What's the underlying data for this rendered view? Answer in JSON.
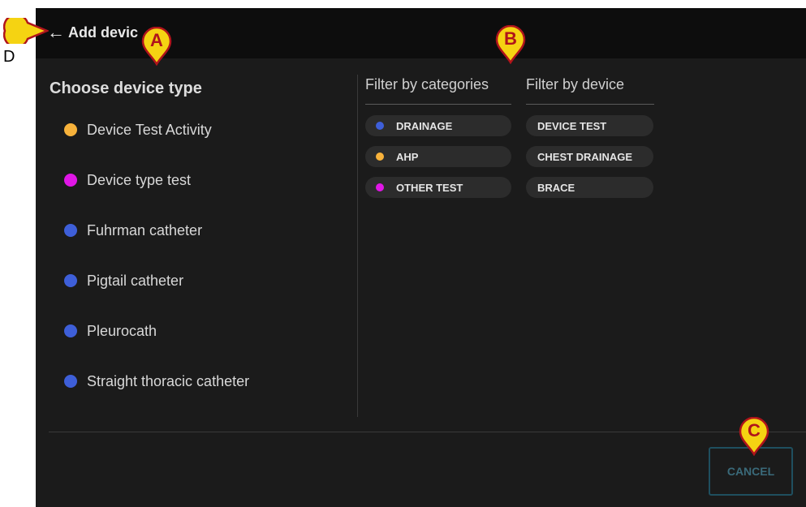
{
  "header": {
    "back_arrow": "←",
    "title": "Add devic"
  },
  "left": {
    "heading": "Choose device type",
    "items": [
      {
        "label": "Device Test Activity",
        "color": "#f7b23b"
      },
      {
        "label": "Device type test",
        "color": "#e016e6"
      },
      {
        "label": "Fuhrman catheter",
        "color": "#3e5fd9"
      },
      {
        "label": "Pigtail catheter",
        "color": "#3e5fd9"
      },
      {
        "label": "Pleurocath",
        "color": "#3e5fd9"
      },
      {
        "label": "Straight thoracic catheter",
        "color": "#3e5fd9"
      }
    ]
  },
  "filters": {
    "categories_title": "Filter by categories",
    "device_title": "Filter by device",
    "categories": [
      {
        "label": "DRAINAGE",
        "color": "#3e5fd9"
      },
      {
        "label": "AHP",
        "color": "#f7b23b"
      },
      {
        "label": "OTHER TEST",
        "color": "#e016e6"
      }
    ],
    "devices": [
      {
        "label": "DEVICE TEST"
      },
      {
        "label": "CHEST DRAINAGE"
      },
      {
        "label": "BRACE"
      }
    ]
  },
  "footer": {
    "cancel_label": "CANCEL"
  },
  "markers": {
    "a": "A",
    "b": "B",
    "c": "C",
    "d": "D",
    "fill": "#f5d312",
    "stroke": "#b0141b"
  }
}
